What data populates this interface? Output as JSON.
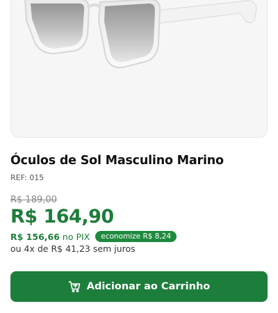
{
  "product": {
    "image_icon": "sunglasses-image",
    "title": "Óculos de Sol Masculino Marino",
    "ref": "REF: 015"
  },
  "pricing": {
    "old_price": "R$ 189,00",
    "price": "R$ 164,90",
    "pix_price": "R$ 156,66",
    "pix_label": "no PIX",
    "savings_badge": "economize R$ 8,24",
    "installments": "ou 4x de R$ 41,23 sem juros"
  },
  "cart_button": {
    "label": "Adicionar ao Carrinho",
    "icon": "cart-icon"
  },
  "colors": {
    "accent_green": "#1d7e3b",
    "badge_green": "#1e8a3e"
  }
}
